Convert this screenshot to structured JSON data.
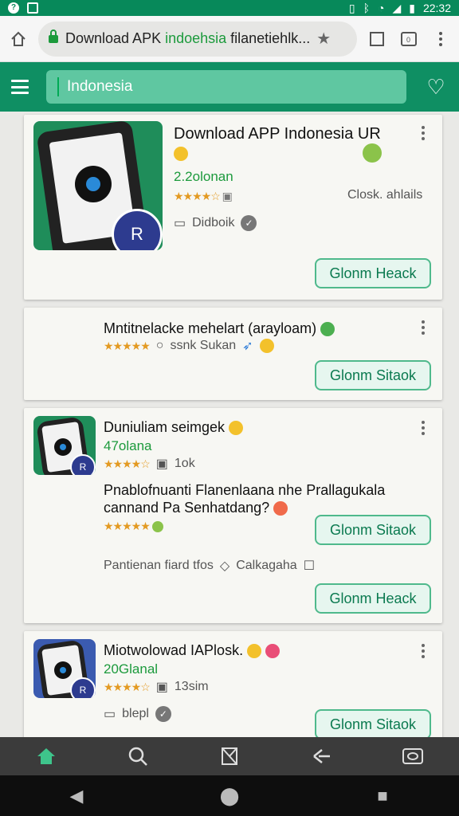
{
  "status_bar": {
    "time": "22:32"
  },
  "browser": {
    "url_prefix": "Download APK ",
    "url_highlight": "indoehsia",
    "url_suffix": " filanetiehlk..."
  },
  "header": {
    "search_value": "Indonesia"
  },
  "cards": [
    {
      "title": "Download APP Indonesia UR",
      "subtitle": "2.2olonan",
      "right_text": "Closk. ahlails",
      "meta": "Didboik",
      "button": "Glonm Heack"
    },
    {
      "title": "Mntitnelacke mehelart (arayloam)",
      "meta": "ssnk Sukan",
      "button": "Glonm Sitaok"
    },
    {
      "title": "Duniuliam seimgek",
      "subtitle": "47olana",
      "meta": "1ok",
      "title2": "Pnablofnuanti Flanenlaana nhe Prallagukala cannand Pa Senhatdang?",
      "button": "Glonm Sitaok",
      "footer_left": "Pantienan fiard tfos",
      "footer_right": "Calkagaha",
      "button2": "Glonm Heack"
    },
    {
      "title": "Miotwolowad IAPlosk.",
      "subtitle": "20Glanal",
      "meta": "13sim",
      "meta2": "blepl",
      "button": "Glonm Sitaok"
    }
  ]
}
